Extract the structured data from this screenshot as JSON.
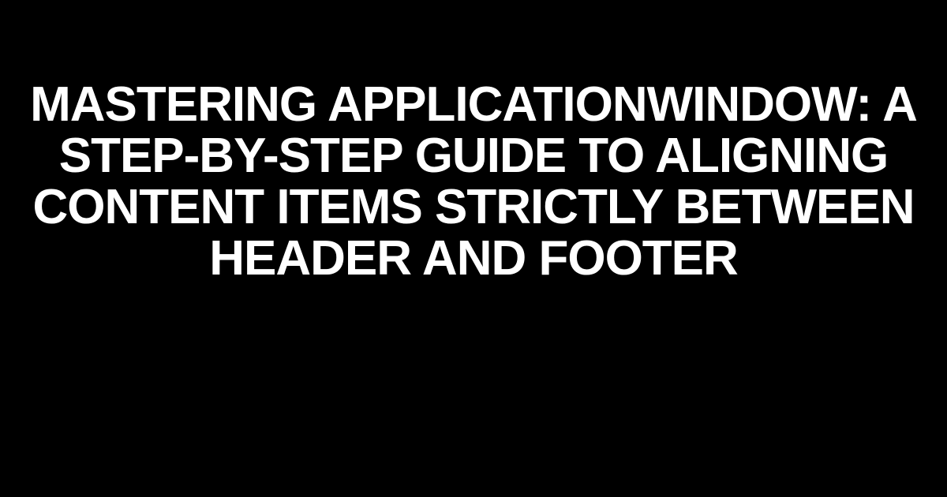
{
  "heading": {
    "text": "Mastering ApplicationWindow: A Step-by-Step Guide to Aligning Content Items Strictly Between Header and Footer"
  }
}
